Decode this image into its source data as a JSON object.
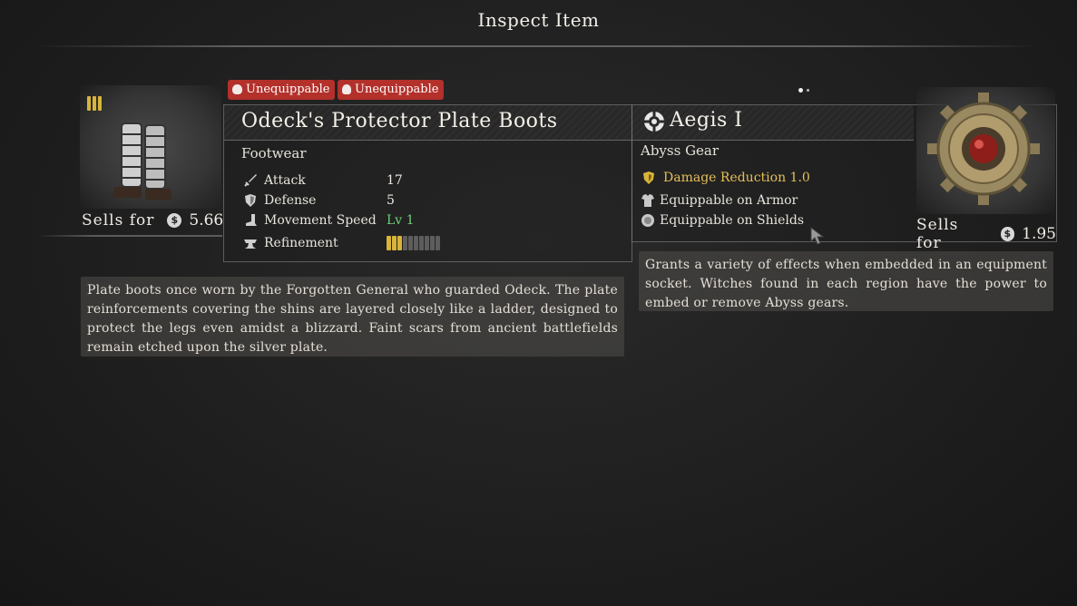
{
  "window": {
    "title": "Inspect Item"
  },
  "left_item": {
    "tier_icon": "tier-three-bars-icon",
    "badges": [
      {
        "label": "Unequippable",
        "icon": "head-slot-icon"
      },
      {
        "label": "Unequippable",
        "icon": "hand-slot-icon"
      }
    ],
    "name": "Odeck's Protector Plate Boots",
    "type": "Footwear",
    "stats": [
      {
        "icon": "sword-icon",
        "label": "Attack",
        "value": "17"
      },
      {
        "icon": "shield-icon",
        "label": "Defense",
        "value": "5"
      },
      {
        "icon": "boot-icon",
        "label": "Movement Speed",
        "value": "Lv 1"
      },
      {
        "icon": "anvil-icon",
        "label": "Refinement",
        "value": ""
      }
    ],
    "refinement_level": 3,
    "refinement_max": 10,
    "sells_label": "Sells for",
    "sell_price": "5.66",
    "description": "Plate boots once worn by the Forgotten General who guarded Odeck. The plate reinforcements covering the shins are layered closely like a ladder, designed to protect the legs even amidst a blizzard. Faint scars from ancient battlefields remain etched upon the silver plate."
  },
  "right_item": {
    "name_icon": "abyss-gear-icon",
    "name": "Aegis I",
    "type": "Abyss Gear",
    "main_effect": "Damage Reduction 1.0",
    "equippable": [
      {
        "icon": "armor-icon",
        "label": "Equippable on Armor"
      },
      {
        "icon": "round-shield-icon",
        "label": "Equippable on Shields"
      }
    ],
    "sells_label": "Sells for",
    "sell_price": "1.95",
    "description": "Grants a variety of effects when embedded in an equipment socket. Witches found in each region have the power to embed or remove Abyss gears."
  },
  "colors": {
    "badge_red": "#b3302b",
    "gold": "#d8b43a",
    "green_value": "#6fcf7a"
  }
}
